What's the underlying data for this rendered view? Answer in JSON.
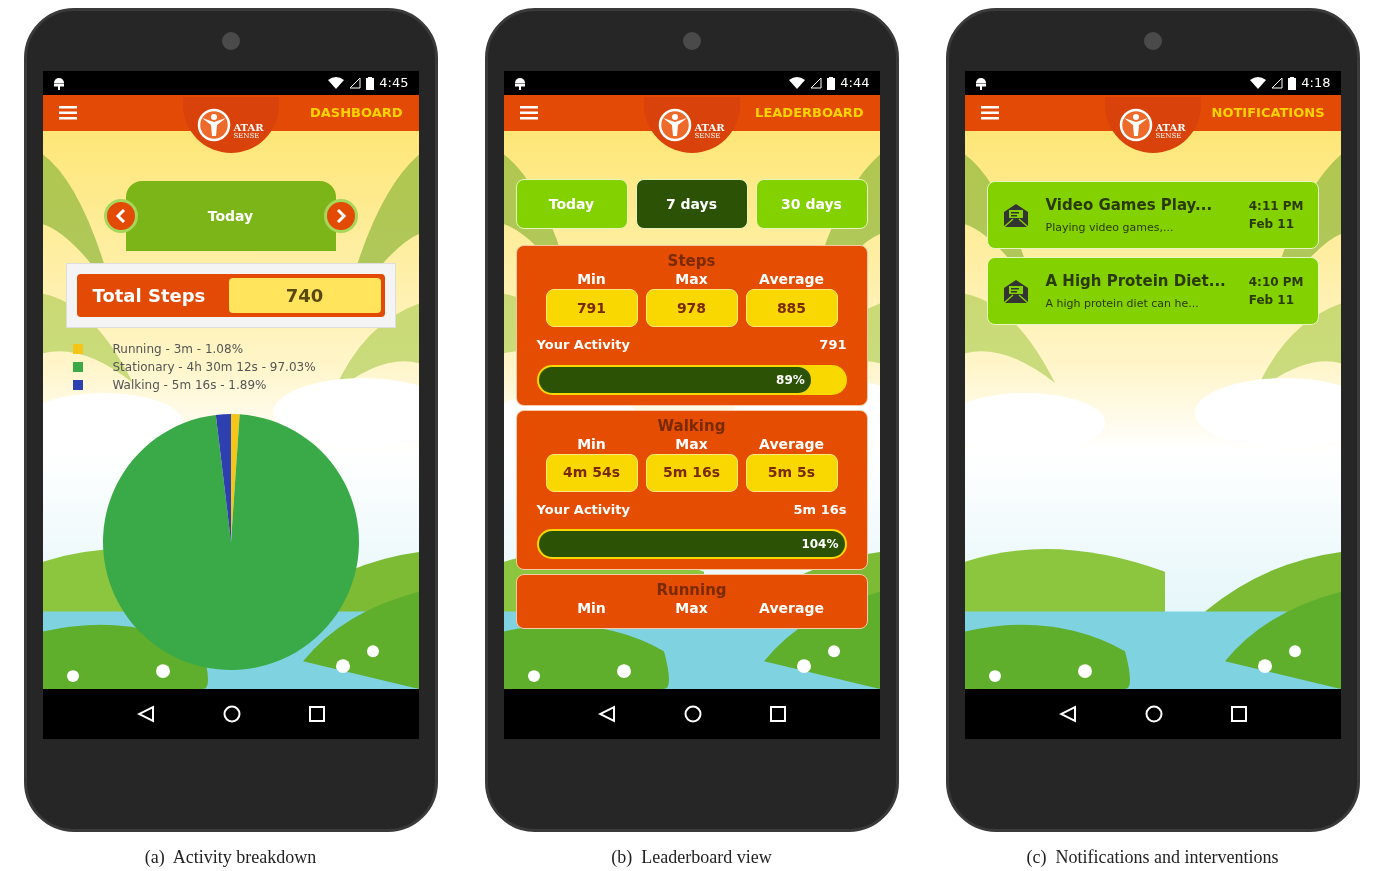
{
  "screens": [
    {
      "kind": "dashboard",
      "status_time": "4:45",
      "title": "DASHBOARD",
      "logo": {
        "upper": "ATAR",
        "lower": "SENSE"
      },
      "period": "Today",
      "total": {
        "label": "Total Steps",
        "value": "740"
      },
      "legend": [
        {
          "text": "Running - 3m - 1.08%",
          "color": "#f5c518"
        },
        {
          "text": "Stationary - 4h 30m 12s - 97.03%",
          "color": "#3aaa48"
        },
        {
          "text": "Walking - 5m 16s - 1.89%",
          "color": "#2e3fb0"
        }
      ],
      "chart_data": {
        "type": "pie",
        "values": [
          1.08,
          97.03,
          1.89
        ]
      },
      "caption": "(a)  Activity breakdown"
    },
    {
      "kind": "leaderboard",
      "status_time": "4:44",
      "title": "LEADERBOARD",
      "logo": {
        "upper": "ATAR",
        "lower": "SENSE"
      },
      "tabs": [
        {
          "label": "Today",
          "selected": false
        },
        {
          "label": "7 days",
          "selected": true
        },
        {
          "label": "30 days",
          "selected": false
        }
      ],
      "sections": [
        {
          "title": "Steps",
          "stats": [
            {
              "label": "Min",
              "value": "791"
            },
            {
              "label": "Max",
              "value": "978"
            },
            {
              "label": "Average",
              "value": "885"
            }
          ],
          "activity_label": "Your Activity",
          "activity_value": "791",
          "level": 0.89,
          "percent": "89%"
        },
        {
          "title": "Walking",
          "stats": [
            {
              "label": "Min",
              "value": "4m 54s"
            },
            {
              "label": "Max",
              "value": "5m 16s"
            },
            {
              "label": "Average",
              "value": "5m 5s"
            }
          ],
          "activity_label": "Your Activity",
          "activity_value": "5m 16s",
          "level": 1,
          "percent": "104%"
        },
        {
          "title": "Running",
          "stats": [
            {
              "label": "Min"
            },
            {
              "label": "Max"
            },
            {
              "label": "Average"
            }
          ]
        }
      ],
      "caption": "(b)  Leaderboard view"
    },
    {
      "kind": "notifications",
      "status_time": "4:18",
      "title": "NOTIFICATIONS",
      "logo": {
        "upper": "ATAR",
        "lower": "SENSE"
      },
      "notifications": [
        {
          "title": "Video Games Play...",
          "body": "Playing video games,...",
          "time": "4:11 PM",
          "date": "Feb 11"
        },
        {
          "title": "A High Protein Diet...",
          "body": "A high protein diet can he...",
          "time": "4:10 PM",
          "date": "Feb 11"
        }
      ],
      "caption": "(c)  Notifications and interventions"
    }
  ]
}
